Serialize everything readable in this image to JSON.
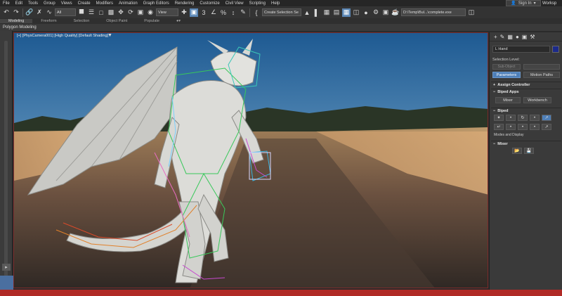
{
  "menu": [
    "File",
    "Edit",
    "Tools",
    "Group",
    "Views",
    "Create",
    "Modifiers",
    "Animation",
    "Graph Editors",
    "Rendering",
    "Customize",
    "Civil View",
    "Scripting",
    "Help"
  ],
  "signin": {
    "label": "Sign In"
  },
  "workspace": {
    "label": "Worksp"
  },
  "toolbar": {
    "filter_select": "All",
    "refcoord_select": "View",
    "selection_set": "Create Selection Se",
    "project_path": "D:\\Temp\\Bul...\\complete.exe"
  },
  "ribbon": {
    "tabs": [
      "Modeling",
      "Freeform",
      "Selection",
      "Object Paint",
      "Populate"
    ],
    "active_tab": "Polygon Modeling"
  },
  "viewport": {
    "label": "[+] [PhysCamera001] [High Quality] [Default Shading]"
  },
  "command_panel": {
    "object_name": "L Hand",
    "selection_level_label": "Selection Level:",
    "sub_object": "Sub-Object",
    "parameters_btn": "Parameters",
    "motion_paths_btn": "Motion Paths",
    "assign_controller": "Assign Controller",
    "biped_apps": "Biped Apps",
    "mixer_btn": "Mixer",
    "workbench_btn": "Workbench",
    "biped": "Biped",
    "modes_display": "Modes and Display",
    "mixer": "Mixer"
  },
  "colors": {
    "accent": "#4e7fb8",
    "viewport_border": "#7a2b2b",
    "status_bar": "#b02a26"
  }
}
